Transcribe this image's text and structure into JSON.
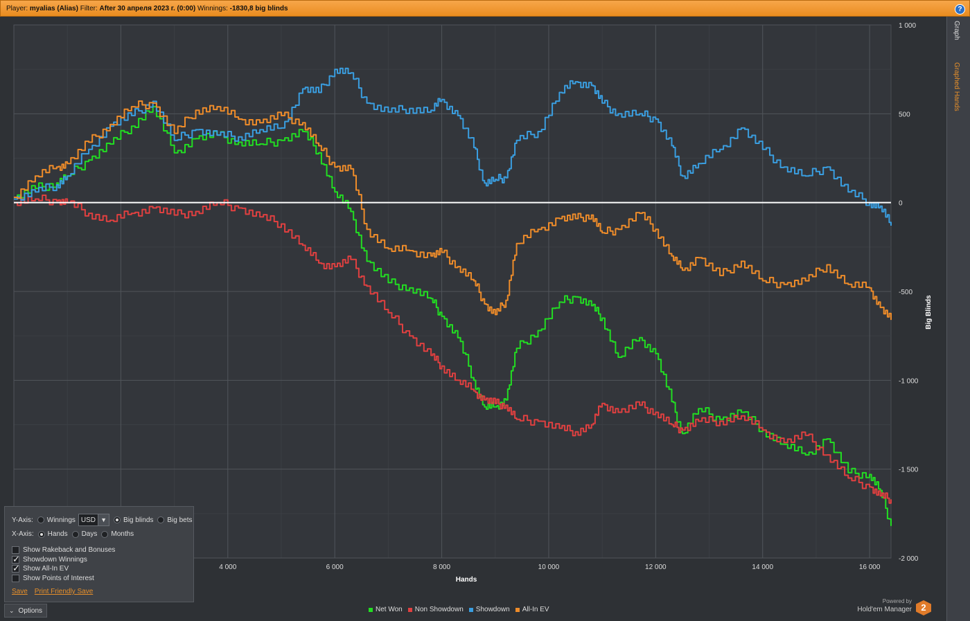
{
  "header": {
    "player_label": "Player:",
    "player_value": "myalias (Alias)",
    "filter_label": "Filter:",
    "filter_value": "After 30 апреля 2023 г. (0:00)",
    "winnings_label": "Winnings:",
    "winnings_value": "-1830,8 big blinds",
    "help_icon": "question-icon"
  },
  "sidebar": {
    "tabs": [
      {
        "label": "Graph"
      },
      {
        "label": "Graphed Hands"
      }
    ],
    "active_color": "#e8902a"
  },
  "chart_data": {
    "type": "line",
    "xlabel": "Hands",
    "ylabel": "Big Blinds",
    "xlim": [
      0,
      16400
    ],
    "ylim": [
      -2000,
      1000
    ],
    "grid": true,
    "x_ticks": [
      0,
      2000,
      4000,
      6000,
      8000,
      10000,
      12000,
      14000,
      16000
    ],
    "x_tick_labels": [
      "",
      "",
      "4 000",
      "6 000",
      "8 000",
      "10 000",
      "12 000",
      "14 000",
      "16 000"
    ],
    "y_ticks": [
      1000,
      500,
      0,
      -500,
      -1000,
      -1500,
      -2000
    ],
    "y_tick_labels": [
      "1 000",
      "500",
      "0",
      "-500",
      "-1 000",
      "-1 500",
      "-2 000"
    ],
    "legend_position": "bottom-center",
    "series": [
      {
        "name": "Net Won",
        "color": "#22dd22",
        "x": [
          0,
          400,
          800,
          1000,
          1400,
          1800,
          2200,
          2600,
          3000,
          3400,
          3800,
          4200,
          4600,
          5000,
          5400,
          5700,
          6000,
          6300,
          6600,
          7000,
          7400,
          7800,
          8000,
          8300,
          8600,
          8800,
          9000,
          9200,
          9400,
          9800,
          10200,
          10500,
          10800,
          11000,
          11300,
          11700,
          12000,
          12300,
          12500,
          12800,
          13200,
          13600,
          14000,
          14400,
          14800,
          15200,
          15600,
          16000,
          16200,
          16400
        ],
        "y": [
          20,
          80,
          110,
          150,
          240,
          330,
          430,
          540,
          280,
          360,
          380,
          340,
          330,
          350,
          400,
          280,
          60,
          -50,
          -330,
          -450,
          -480,
          -540,
          -640,
          -760,
          -1000,
          -1150,
          -1150,
          -1110,
          -820,
          -720,
          -560,
          -530,
          -580,
          -650,
          -870,
          -760,
          -850,
          -1120,
          -1300,
          -1160,
          -1220,
          -1180,
          -1280,
          -1360,
          -1420,
          -1330,
          -1520,
          -1530,
          -1620,
          -1820
        ]
      },
      {
        "name": "Non Showdown",
        "color": "#e04040",
        "x": [
          0,
          400,
          800,
          1000,
          1400,
          1800,
          2200,
          2600,
          3000,
          3400,
          3800,
          4200,
          4600,
          5000,
          5400,
          5700,
          6000,
          6300,
          6600,
          7000,
          7400,
          7800,
          8000,
          8300,
          8600,
          8800,
          9000,
          9200,
          9400,
          9800,
          10200,
          10500,
          10800,
          11000,
          11300,
          11700,
          12000,
          12300,
          12500,
          12800,
          13200,
          13600,
          14000,
          14400,
          14800,
          15200,
          15600,
          16000,
          16200,
          16400
        ],
        "y": [
          0,
          20,
          10,
          0,
          -60,
          -100,
          -60,
          -30,
          -70,
          -50,
          0,
          -30,
          -80,
          -120,
          -240,
          -340,
          -360,
          -320,
          -470,
          -620,
          -750,
          -860,
          -920,
          -1000,
          -1060,
          -1110,
          -1130,
          -1140,
          -1220,
          -1230,
          -1270,
          -1290,
          -1250,
          -1130,
          -1180,
          -1140,
          -1180,
          -1250,
          -1280,
          -1230,
          -1230,
          -1200,
          -1280,
          -1350,
          -1310,
          -1420,
          -1550,
          -1600,
          -1650,
          -1670
        ]
      },
      {
        "name": "Showdown",
        "color": "#3a9ee0",
        "x": [
          0,
          400,
          800,
          1000,
          1400,
          1800,
          2200,
          2600,
          3000,
          3400,
          3800,
          4200,
          4600,
          5000,
          5400,
          5700,
          6000,
          6300,
          6600,
          7000,
          7400,
          7800,
          8000,
          8300,
          8600,
          8800,
          9000,
          9200,
          9400,
          9800,
          10200,
          10500,
          10800,
          11000,
          11300,
          11700,
          12000,
          12300,
          12500,
          12800,
          13200,
          13600,
          14000,
          14400,
          14800,
          15200,
          15600,
          16000,
          16200,
          16400
        ],
        "y": [
          20,
          60,
          100,
          150,
          300,
          430,
          490,
          570,
          350,
          410,
          380,
          370,
          410,
          420,
          640,
          620,
          750,
          730,
          560,
          510,
          530,
          520,
          580,
          490,
          310,
          110,
          130,
          140,
          350,
          400,
          620,
          680,
          660,
          560,
          500,
          500,
          470,
          320,
          150,
          220,
          300,
          420,
          300,
          200,
          150,
          200,
          60,
          0,
          -20,
          -130
        ]
      },
      {
        "name": "All-In EV",
        "color": "#ee8c2a",
        "x": [
          0,
          400,
          800,
          1000,
          1400,
          1800,
          2200,
          2600,
          3000,
          3400,
          3800,
          4200,
          4600,
          5000,
          5400,
          5700,
          6000,
          6300,
          6600,
          7000,
          7400,
          7800,
          8000,
          8300,
          8600,
          8800,
          9000,
          9200,
          9400,
          9800,
          10200,
          10500,
          10800,
          11000,
          11300,
          11700,
          12000,
          12300,
          12500,
          12800,
          13200,
          13600,
          14000,
          14400,
          14800,
          15200,
          15600,
          16000,
          16200,
          16400
        ],
        "y": [
          30,
          150,
          200,
          220,
          340,
          440,
          540,
          560,
          390,
          520,
          540,
          470,
          450,
          490,
          450,
          320,
          200,
          190,
          -150,
          -260,
          -270,
          -300,
          -280,
          -360,
          -440,
          -570,
          -630,
          -550,
          -230,
          -150,
          -90,
          -90,
          -70,
          -170,
          -150,
          -60,
          -150,
          -300,
          -380,
          -310,
          -410,
          -330,
          -440,
          -460,
          -440,
          -350,
          -460,
          -480,
          -590,
          -660
        ]
      }
    ]
  },
  "options": {
    "y_axis_label": "Y-Axis:",
    "y_axis_options": [
      {
        "label": "Winnings",
        "selected": false
      },
      {
        "label": "Big blinds",
        "selected": true
      },
      {
        "label": "Big bets",
        "selected": false
      }
    ],
    "currency_value": "USD",
    "x_axis_label": "X-Axis:",
    "x_axis_options": [
      {
        "label": "Hands",
        "selected": true
      },
      {
        "label": "Days",
        "selected": false
      },
      {
        "label": "Months",
        "selected": false
      }
    ],
    "checkboxes": [
      {
        "label": "Show Rakeback and Bonuses",
        "checked": false
      },
      {
        "label": "Showdown Winnings",
        "checked": true
      },
      {
        "label": "Show All-In EV",
        "checked": true
      },
      {
        "label": "Show Points of Interest",
        "checked": false
      }
    ],
    "save_label": "Save",
    "print_save_label": "Print Friendly Save",
    "toggle_label": "Options"
  },
  "branding": {
    "powered_by": "Powered by",
    "product": "Hold'em Manager",
    "logo_text": "2"
  }
}
